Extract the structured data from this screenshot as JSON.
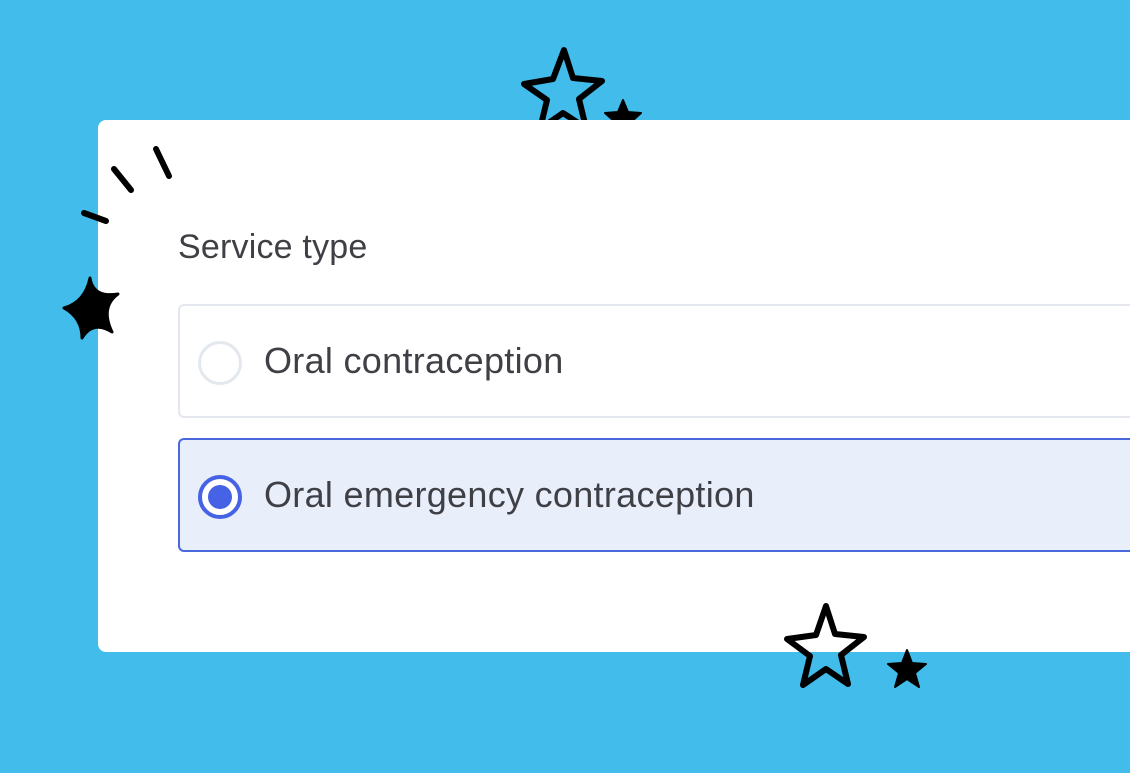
{
  "form": {
    "label": "Service type",
    "options": [
      {
        "label": "Oral contraception",
        "selected": false
      },
      {
        "label": "Oral emergency contraception",
        "selected": true
      }
    ]
  },
  "colors": {
    "background": "#42bcea",
    "accent": "#4563e4",
    "selected_fill": "#e9eefb",
    "text": "#3f3f46"
  },
  "decorations": [
    "star-outline-icon",
    "star-filled-icon",
    "sparkle-lines-icon"
  ]
}
